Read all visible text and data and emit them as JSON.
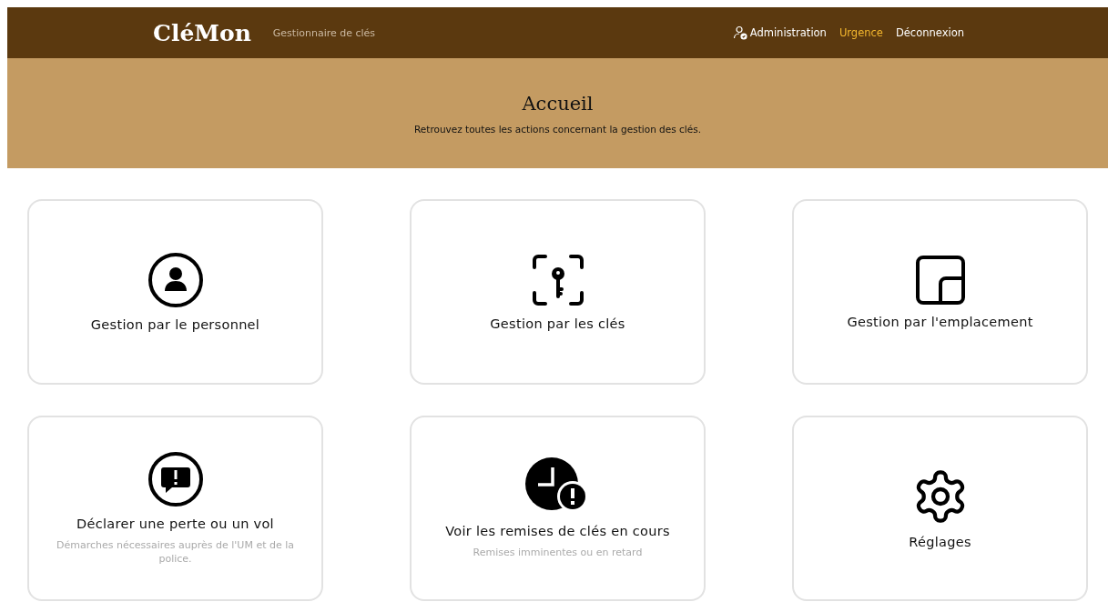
{
  "header": {
    "logo": "CléMon",
    "tagline": "Gestionnaire de clés",
    "links": [
      {
        "label": "Administration",
        "kind": "admin"
      },
      {
        "label": "Urgence",
        "kind": "urgent"
      },
      {
        "label": "Déconnexion",
        "kind": "plain"
      }
    ]
  },
  "banner": {
    "title": "Accueil",
    "subtitle": "Retrouvez toutes les actions concernant la gestion des clés."
  },
  "cards": [
    {
      "kind": "person",
      "title": "Gestion par le personnel"
    },
    {
      "kind": "key",
      "title": "Gestion par les clés"
    },
    {
      "kind": "layout",
      "title": "Gestion par l'emplacement"
    },
    {
      "kind": "alert",
      "title": "Déclarer une perte ou un vol",
      "subtitle": "Démarches nécessaires auprès de l'UM et de la police."
    },
    {
      "kind": "clock",
      "title": "Voir les remises de clés en cours",
      "subtitle": "Remises imminentes ou en retard"
    },
    {
      "kind": "gear",
      "title": "Réglages"
    }
  ]
}
